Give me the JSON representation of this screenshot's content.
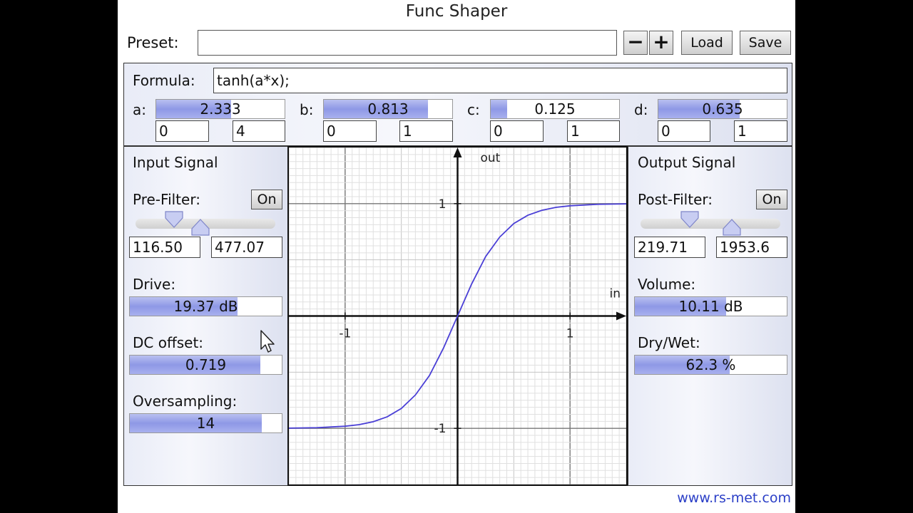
{
  "app": {
    "title": "Func Shaper",
    "footer": "www.rs-met.com"
  },
  "preset": {
    "label": "Preset:",
    "value": "",
    "minus": "−",
    "plus": "+",
    "load": "Load",
    "save": "Save"
  },
  "formula": {
    "label": "Formula:",
    "value": "tanh(a*x);"
  },
  "params": [
    {
      "name": "a:",
      "value": "2.333",
      "fraction": 0.583,
      "min": "0",
      "max": "4"
    },
    {
      "name": "b:",
      "value": "0.813",
      "fraction": 0.813,
      "min": "0",
      "max": "1"
    },
    {
      "name": "c:",
      "value": "0.125",
      "fraction": 0.125,
      "min": "0",
      "max": "1"
    },
    {
      "name": "d:",
      "value": "0.635",
      "fraction": 0.635,
      "min": "0",
      "max": "1"
    }
  ],
  "input": {
    "title": "Input Signal",
    "prefilter_label": "Pre-Filter:",
    "prefilter_toggle": "On",
    "low": "116.50",
    "high": "477.07",
    "drive_label": "Drive:",
    "drive_value": "19.37 dB",
    "drive_fraction": 0.71,
    "dc_label": "DC offset:",
    "dc_value": "0.719",
    "dc_fraction": 0.86,
    "os_label": "Oversampling:",
    "os_value": "14",
    "os_fraction": 0.87
  },
  "output": {
    "title": "Output Signal",
    "postfilter_label": "Post-Filter:",
    "postfilter_toggle": "On",
    "low": "219.71",
    "high": "1953.6",
    "volume_label": "Volume:",
    "volume_value": "10.11 dB",
    "volume_fraction": 0.6,
    "drywet_label": "Dry/Wet:",
    "drywet_value": "62.3 %",
    "drywet_fraction": 0.623
  },
  "chart_data": {
    "type": "line",
    "xlabel": "in",
    "ylabel": "out",
    "xlim": [
      -1.5,
      1.5
    ],
    "ylim": [
      -1.5,
      1.5
    ],
    "x_ticks": [
      "-1",
      "1"
    ],
    "y_ticks": [
      "1",
      "-1"
    ],
    "grid": true,
    "series": [
      {
        "values": [
          [
            -1.5,
            -0.998
          ],
          [
            -1.25,
            -0.994
          ],
          [
            -1.0,
            -0.981
          ],
          [
            -0.875,
            -0.967
          ],
          [
            -0.75,
            -0.941
          ],
          [
            -0.625,
            -0.897
          ],
          [
            -0.5,
            -0.823
          ],
          [
            -0.375,
            -0.703
          ],
          [
            -0.25,
            -0.53
          ],
          [
            -0.125,
            -0.285
          ],
          [
            0,
            0
          ],
          [
            0.125,
            0.285
          ],
          [
            0.25,
            0.53
          ],
          [
            0.375,
            0.703
          ],
          [
            0.5,
            0.823
          ],
          [
            0.625,
            0.897
          ],
          [
            0.75,
            0.941
          ],
          [
            0.875,
            0.967
          ],
          [
            1.0,
            0.981
          ],
          [
            1.25,
            0.994
          ],
          [
            1.5,
            0.998
          ]
        ],
        "color": "#4a3fd6"
      }
    ]
  }
}
